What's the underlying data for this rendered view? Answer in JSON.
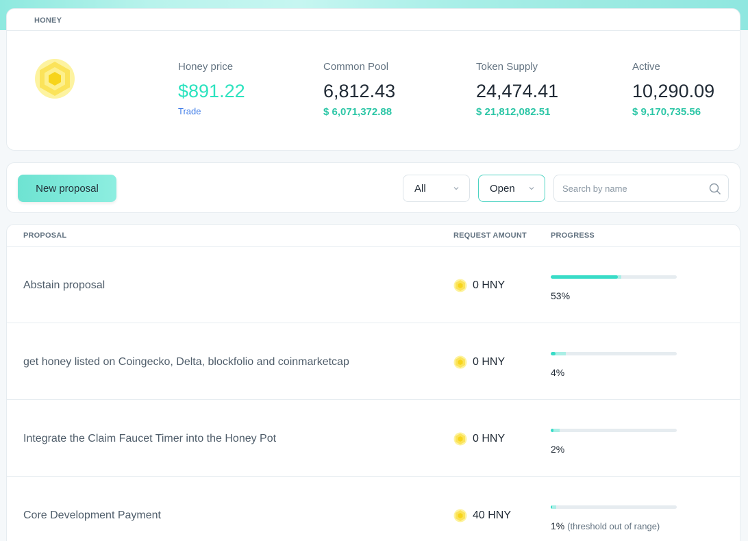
{
  "header": {
    "tag": "HONEY"
  },
  "stats": {
    "honey_price": {
      "label": "Honey price",
      "value": "$891.22",
      "link": "Trade"
    },
    "common_pool": {
      "label": "Common Pool",
      "value": "6,812.43",
      "usd": "$ 6,071,372.88"
    },
    "token_supply": {
      "label": "Token Supply",
      "value": "24,474.41",
      "usd": "$ 21,812,082.51"
    },
    "active": {
      "label": "Active",
      "value": "10,290.09",
      "usd": "$ 9,170,735.56"
    }
  },
  "filters": {
    "new_proposal": "New proposal",
    "type_select": "All",
    "status_select": "Open",
    "search_placeholder": "Search by name"
  },
  "table": {
    "headers": {
      "proposal": "PROPOSAL",
      "request_amount": "REQUEST AMOUNT",
      "progress": "PROGRESS"
    },
    "rows": [
      {
        "name": "Abstain proposal",
        "amount": "0 HNY",
        "progress": 53,
        "progress_text": "53%",
        "note": ""
      },
      {
        "name": "get honey listed on Coingecko, Delta, blockfolio and coinmarketcap",
        "amount": "0 HNY",
        "progress": 4,
        "progress_text": "4%",
        "note": ""
      },
      {
        "name": "Integrate the Claim Faucet Timer into the Honey Pot",
        "amount": "0 HNY",
        "progress": 2,
        "progress_text": "2%",
        "note": ""
      },
      {
        "name": "Core Development Payment",
        "amount": "40 HNY",
        "progress": 1,
        "progress_text": "1%",
        "note": "(threshold out of range)"
      }
    ]
  },
  "colors": {
    "accent": "#2ce3bf",
    "link": "#3f7ce8",
    "honey": "#fce94f"
  }
}
